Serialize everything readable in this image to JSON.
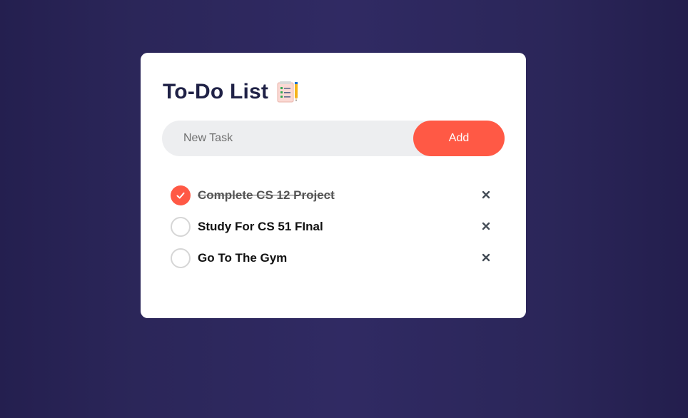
{
  "app": {
    "title": "To-Do List",
    "title_icon": "notepad-checklist-icon"
  },
  "input": {
    "placeholder": "New Task",
    "value": "",
    "add_label": "Add"
  },
  "tasks": [
    {
      "label": "Complete CS 12 Project",
      "completed": true
    },
    {
      "label": "Study For CS 51 FInal",
      "completed": false
    },
    {
      "label": "Go To The Gym",
      "completed": false
    }
  ],
  "colors": {
    "accent": "#ff5945",
    "title": "#1f2146",
    "background": "#2b2659",
    "card": "#ffffff",
    "input_bg": "#edeef0"
  }
}
